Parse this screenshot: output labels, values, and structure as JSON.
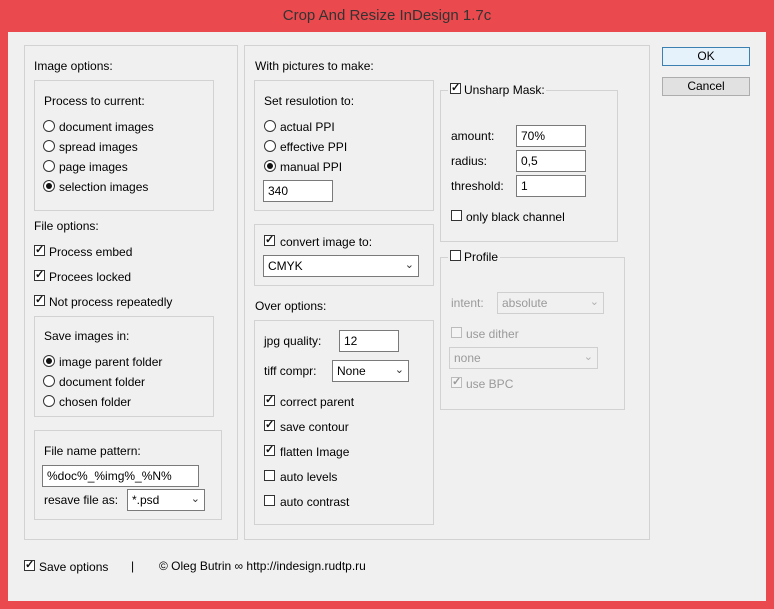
{
  "window": {
    "title": "Crop And Resize InDesign 1.7c"
  },
  "buttons": {
    "ok": "OK",
    "cancel": "Cancel"
  },
  "image_options": {
    "heading": "Image options:",
    "process_heading": "Process to current:",
    "process_options": [
      "document images",
      "spread images",
      "page images",
      "selection images"
    ],
    "process_selected": "selection images"
  },
  "file_options": {
    "heading": "File options:",
    "process_embed": {
      "label": "Process embed",
      "checked": true
    },
    "process_locked": {
      "label": "Procees locked",
      "checked": true
    },
    "not_process_repeatedly": {
      "label": "Not process repeatedly",
      "checked": true
    },
    "save_heading": "Save images in:",
    "save_options": [
      "image parent folder",
      "document folder",
      "chosen folder"
    ],
    "save_selected": "image parent folder",
    "pattern_heading": "File name pattern:",
    "pattern_value": "%doc%_%img%_%N%",
    "resave_label": "resave file as:",
    "resave_value": "*.psd"
  },
  "pictures": {
    "heading": "With pictures to make:",
    "resolution_heading": "Set resulotion to:",
    "resolution_options": [
      "actual PPI",
      "effective PPI",
      "manual PPI"
    ],
    "resolution_selected": "manual PPI",
    "ppi_value": "340",
    "convert": {
      "label": "convert image to:",
      "checked": true
    },
    "convert_value": "CMYK"
  },
  "over_options": {
    "heading": "Over options:",
    "jpg_label": "jpg quality:",
    "jpg_value": "12",
    "tiff_label": "tiff compr:",
    "tiff_value": "None",
    "checks": [
      {
        "label": "correct parent",
        "checked": true
      },
      {
        "label": "save contour",
        "checked": true
      },
      {
        "label": "flatten Image",
        "checked": true
      },
      {
        "label": "auto levels",
        "checked": false
      },
      {
        "label": "auto contrast",
        "checked": false
      }
    ]
  },
  "unsharp": {
    "label": "Unsharp Mask:",
    "checked": true,
    "amount_label": "amount:",
    "amount_value": "70%",
    "radius_label": "radius:",
    "radius_value": "0,5",
    "threshold_label": "threshold:",
    "threshold_value": "1",
    "only_black": {
      "label": "only black channel",
      "checked": false
    }
  },
  "profile": {
    "label": "Profile",
    "checked": false,
    "intent_label": "intent:",
    "intent_value": "absolute",
    "use_dither": {
      "label": "use dither",
      "checked": false
    },
    "profile_value": "none",
    "use_bpc": {
      "label": "use BPC",
      "checked": true
    }
  },
  "footer": {
    "save_options": {
      "label": "Save options",
      "checked": true
    },
    "separator": "|",
    "credit": "© Oleg Butrin ∞ http://indesign.rudtp.ru"
  }
}
